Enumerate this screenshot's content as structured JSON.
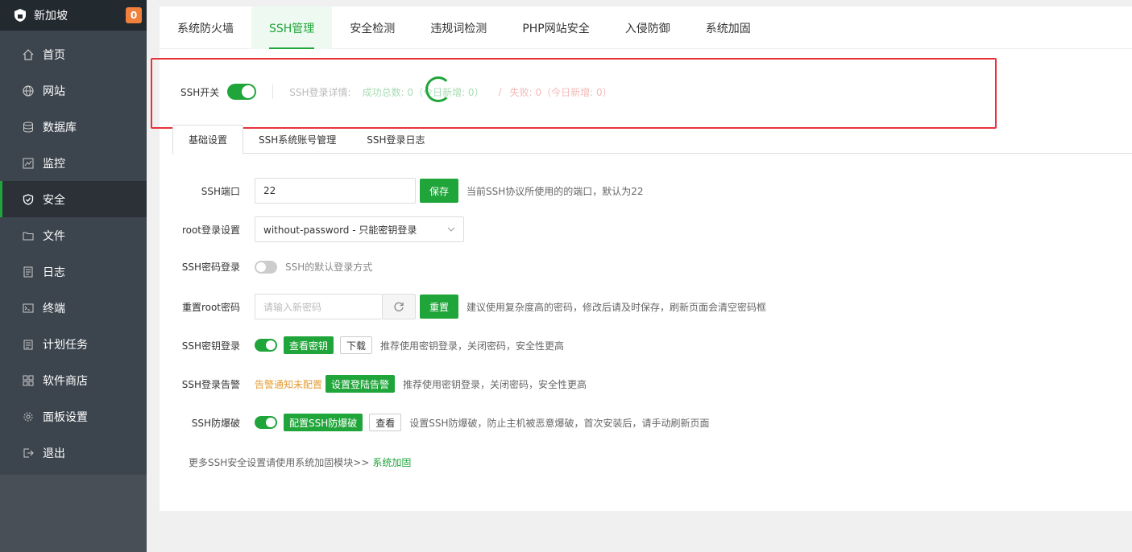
{
  "sidebar": {
    "site_name": "新加坡",
    "badge": "0",
    "items": [
      {
        "label": "首页",
        "icon": "home-icon"
      },
      {
        "label": "网站",
        "icon": "globe-icon"
      },
      {
        "label": "数据库",
        "icon": "database-icon"
      },
      {
        "label": "监控",
        "icon": "monitor-icon"
      },
      {
        "label": "安全",
        "icon": "shield-icon"
      },
      {
        "label": "文件",
        "icon": "folder-icon"
      },
      {
        "label": "日志",
        "icon": "log-icon"
      },
      {
        "label": "终端",
        "icon": "terminal-icon"
      },
      {
        "label": "计划任务",
        "icon": "calendar-icon"
      },
      {
        "label": "软件商店",
        "icon": "grid-icon"
      },
      {
        "label": "面板设置",
        "icon": "gear-icon"
      },
      {
        "label": "退出",
        "icon": "logout-icon"
      }
    ]
  },
  "topnav": [
    "系统防火墙",
    "SSH管理",
    "安全检测",
    "违规词检测",
    "PHP网站安全",
    "入侵防御",
    "系统加固"
  ],
  "ssh_bar": {
    "switch_label": "SSH开关",
    "detail_label": "SSH登录详情:",
    "success": "成功总数: 0（今日新增: 0）",
    "sep": "/",
    "fail": "失败: 0（今日新增: 0）"
  },
  "subtabs": [
    "基础设置",
    "SSH系统账号管理",
    "SSH登录日志"
  ],
  "form": {
    "port_label": "SSH端口",
    "port_value": "22",
    "save": "保存",
    "port_hint": "当前SSH协议所使用的的端口，默认为22",
    "root_label": "root登录设置",
    "root_value": "without-password - 只能密钥登录",
    "pwd_login_label": "SSH密码登录",
    "pwd_login_hint": "SSH的默认登录方式",
    "reset_label": "重置root密码",
    "reset_placeholder": "请输入新密码",
    "reset_btn": "重置",
    "reset_hint": "建议使用复杂度高的密码，修改后请及时保存，刷新页面会清空密码框",
    "key_label": "SSH密钥登录",
    "view_key": "查看密钥",
    "download": "下载",
    "key_hint": "推荐使用密钥登录，关闭密码，安全性更高",
    "alarm_label": "SSH登录告警",
    "alarm_warn": "告警通知未配置",
    "alarm_btn": "设置登陆告警",
    "alarm_hint": "推荐使用密钥登录，关闭密码，安全性更高",
    "brute_label": "SSH防爆破",
    "brute_btn": "配置SSH防爆破",
    "brute_view": "查看",
    "brute_hint": "设置SSH防爆破，防止主机被恶意爆破，首次安装后，请手动刷新页面",
    "more_text": "更多SSH安全设置请使用系统加固模块>> ",
    "more_link": "系统加固"
  },
  "colors": {
    "accent": "#20a53a",
    "sidebar": "#3c444d",
    "highlight": "#e8323a",
    "badge": "#f0803c"
  }
}
